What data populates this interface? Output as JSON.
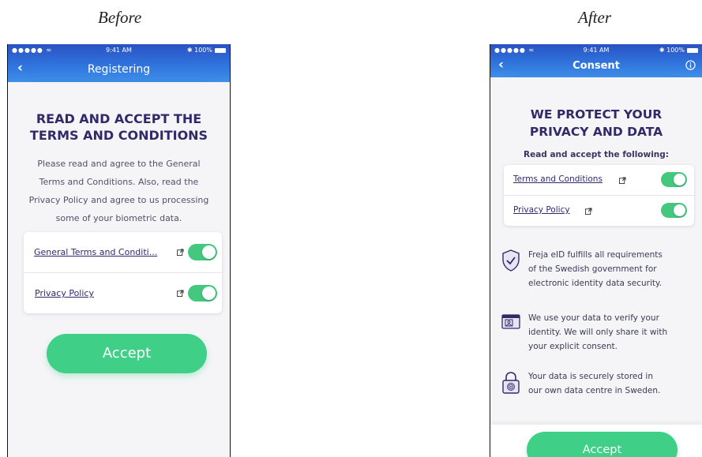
{
  "captions": {
    "before": "Before",
    "after": "After"
  },
  "before": {
    "status": {
      "signal": "●●●●● ≈",
      "time": "9:41 AM",
      "battery": "✱ 100%"
    },
    "nav_title": "Registering",
    "heading_line1": "READ AND ACCEPT THE",
    "heading_line2": "TERMS AND CONDITIONS",
    "body_lines": [
      "Please read and agree to the General",
      "Terms and Conditions. Also, read the",
      "Privacy Policy and agree to us processing",
      "some of your biometric data."
    ],
    "rows": [
      {
        "label": "General Terms and Conditi...",
        "toggle_on": true
      },
      {
        "label": "Privacy Policy",
        "toggle_on": true
      }
    ],
    "accept_label": "Accept"
  },
  "after": {
    "status": {
      "signal": "●●●●● ≈",
      "time": "9:41 AM",
      "battery": "✱ 100%"
    },
    "nav_title": "Consent",
    "heading_line1": "WE PROTECT YOUR",
    "heading_line2": "PRIVACY AND DATA",
    "subheading": "Read and accept the following:",
    "rows": [
      {
        "label": "Terms and Conditions",
        "toggle_on": true
      },
      {
        "label": "Privacy Policy",
        "toggle_on": true
      }
    ],
    "features": [
      {
        "icon": "shield-check-icon",
        "lines": [
          "Freja eID fulfills all requirements",
          "of the Swedish government for",
          "electronic identity data security."
        ]
      },
      {
        "icon": "id-card-icon",
        "lines": [
          "We use your data to verify your",
          "identity. We will only share it with",
          "your explicit consent."
        ]
      },
      {
        "icon": "padlock-fingerprint-icon",
        "lines": [
          "Your data is securely stored in",
          "our own data centre in Sweden."
        ]
      }
    ],
    "accept_label": "Accept"
  },
  "colors": {
    "accent_green": "#43c87e",
    "header_blue": "#2f73dd",
    "heading_navy": "#312a68"
  }
}
